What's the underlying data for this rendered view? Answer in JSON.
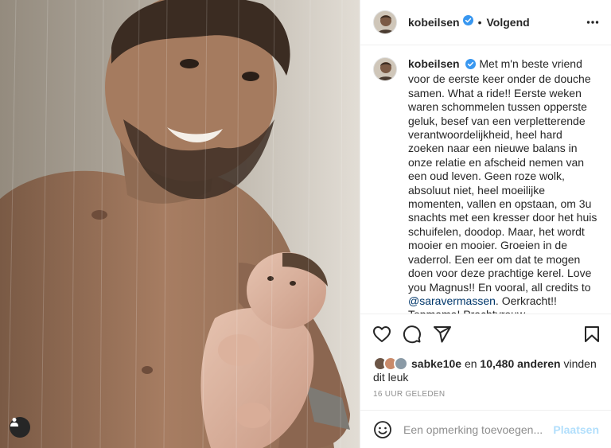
{
  "post": {
    "photo": {
      "alt_icon": "user-tag-icon"
    },
    "header": {
      "username": "kobeilsen",
      "verified": true,
      "separator": "•",
      "follow_label": "Volgend",
      "more_icon": "more-dots-icon"
    },
    "caption": {
      "username": "kobeilsen",
      "text_before": "Met m'n beste vriend voor de eerste keer onder de douche samen. What a ride!! Eerste weken waren schommelen tussen opperste geluk, besef van een verpletterende verantwoordelijkheid, heel hard zoeken naar een nieuwe balans in onze relatie en afscheid nemen van een oud leven. Geen roze wolk, absoluut niet, heel moeilijke momenten, vallen en opstaan, om 3u snachts met een kresser door het huis schuifelen, doodop. Maar, het wordt mooier en mooier. Groeien in de vaderrol. Een eer om dat te mogen doen voor deze prachtige kerel. Love you Magnus!! En vooral, all credits to ",
      "mention": "@saravermassen",
      "text_after": ". Oerkracht!! Topmama! Prachtvrouw."
    },
    "actions": {
      "like_icon": "heart-icon",
      "comment_icon": "comment-icon",
      "share_icon": "share-icon",
      "save_icon": "bookmark-icon"
    },
    "likes": {
      "first_user": "sabke10e",
      "middle": " en ",
      "count": "10,480 anderen",
      "suffix": " vinden dit leuk"
    },
    "timestamp": "16 UUR GELEDEN",
    "comment": {
      "placeholder": "Een opmerking toevoegen...",
      "post_label": "Plaatsen",
      "emoji_icon": "emoji-icon"
    }
  },
  "colors": {
    "text": "#262626",
    "secondary": "#8e8e8e",
    "verified": "#3897f0",
    "mention": "#00376b",
    "post_disabled": "#b2dffc",
    "divider": "#efefef"
  }
}
